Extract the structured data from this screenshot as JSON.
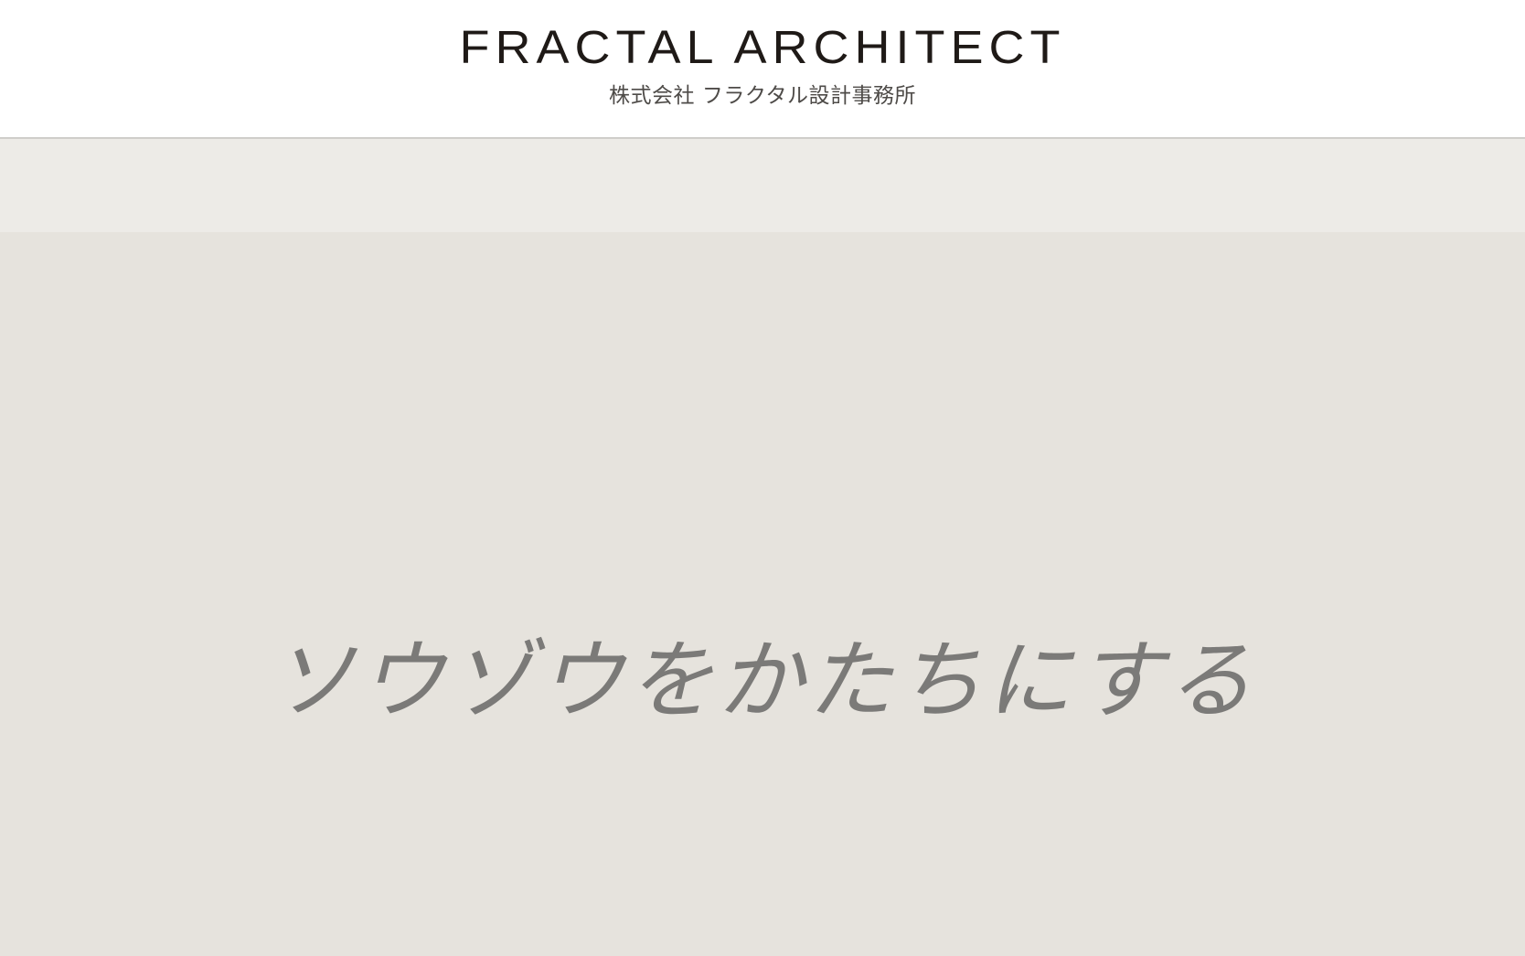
{
  "header": {
    "logo_title": "FRACTAL ARCHITECT",
    "logo_subtitle": "株式会社 フラクタル設計事務所"
  },
  "hero": {
    "tagline": "ソウゾウをかたちにする"
  },
  "colors": {
    "header_bg": "#ffffff",
    "hero_band": "#edebe7",
    "hero_bg": "#e6e3dd",
    "tagline": "#7b7a78",
    "logo_text": "#1f1a17"
  }
}
